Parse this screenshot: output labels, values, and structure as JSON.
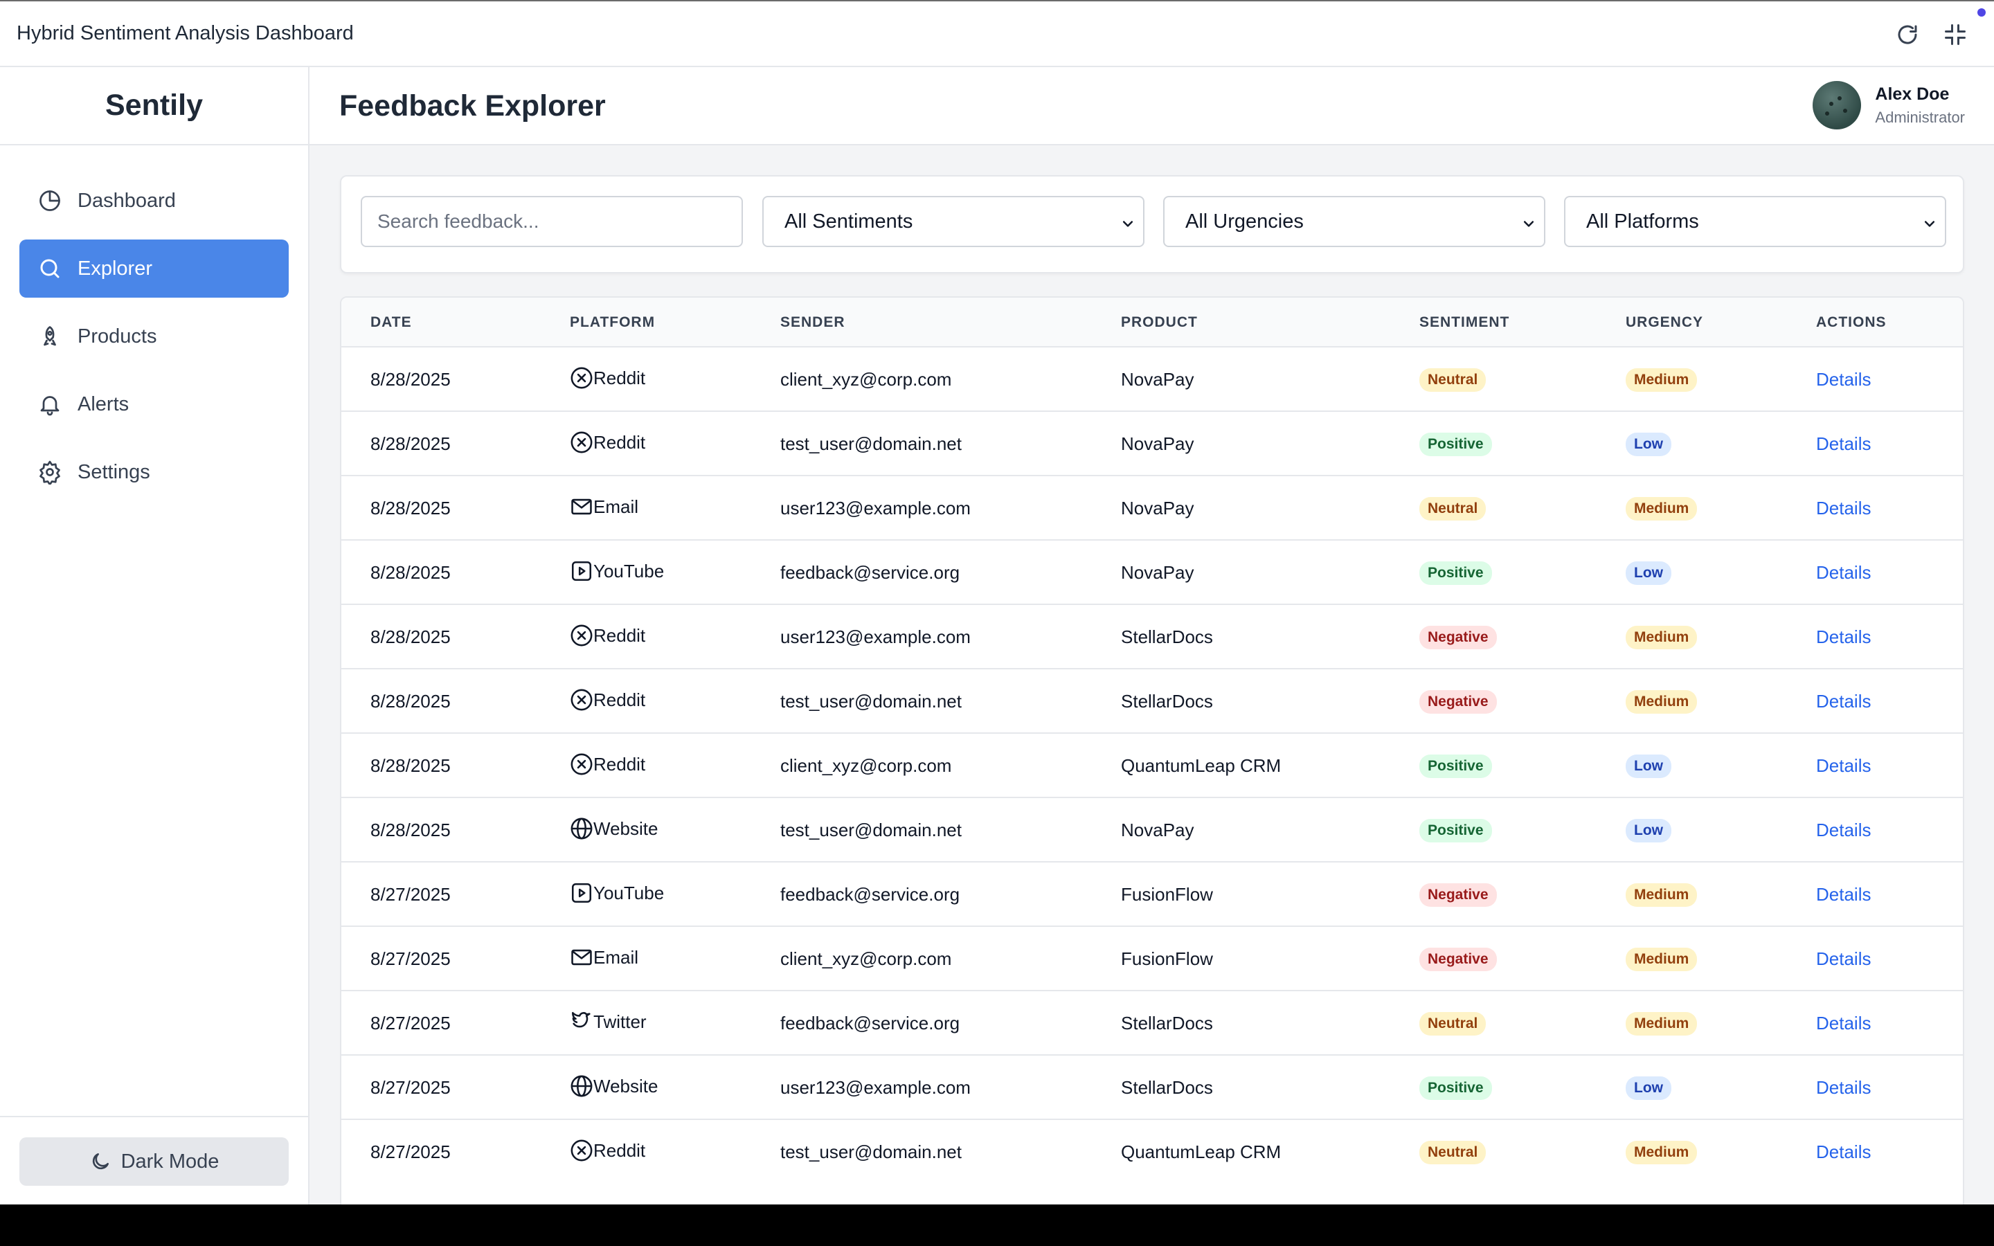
{
  "window": {
    "title": "Hybrid Sentiment Analysis Dashboard"
  },
  "sidebar": {
    "brand": "Sentily",
    "items": [
      {
        "label": "Dashboard",
        "icon": "pie-chart-icon",
        "active": false
      },
      {
        "label": "Explorer",
        "icon": "search-icon",
        "active": true
      },
      {
        "label": "Products",
        "icon": "rocket-icon",
        "active": false
      },
      {
        "label": "Alerts",
        "icon": "bell-icon",
        "active": false
      },
      {
        "label": "Settings",
        "icon": "gear-icon",
        "active": false
      }
    ],
    "dark_mode_label": "Dark Mode"
  },
  "header": {
    "title": "Feedback Explorer",
    "user_name": "Alex Doe",
    "user_role": "Administrator"
  },
  "filters": {
    "search_placeholder": "Search feedback...",
    "sentiment": "All Sentiments",
    "urgency": "All Urgencies",
    "platform": "All Platforms"
  },
  "table": {
    "columns": [
      "DATE",
      "PLATFORM",
      "SENDER",
      "PRODUCT",
      "SENTIMENT",
      "URGENCY",
      "ACTIONS"
    ],
    "rows": [
      {
        "date": "8/28/2025",
        "platform": "Reddit",
        "sender": "client_xyz@corp.com",
        "product": "NovaPay",
        "sentiment": "Neutral",
        "urgency": "Medium",
        "action": "Details"
      },
      {
        "date": "8/28/2025",
        "platform": "Reddit",
        "sender": "test_user@domain.net",
        "product": "NovaPay",
        "sentiment": "Positive",
        "urgency": "Low",
        "action": "Details"
      },
      {
        "date": "8/28/2025",
        "platform": "Email",
        "sender": "user123@example.com",
        "product": "NovaPay",
        "sentiment": "Neutral",
        "urgency": "Medium",
        "action": "Details"
      },
      {
        "date": "8/28/2025",
        "platform": "YouTube",
        "sender": "feedback@service.org",
        "product": "NovaPay",
        "sentiment": "Positive",
        "urgency": "Low",
        "action": "Details"
      },
      {
        "date": "8/28/2025",
        "platform": "Reddit",
        "sender": "user123@example.com",
        "product": "StellarDocs",
        "sentiment": "Negative",
        "urgency": "Medium",
        "action": "Details"
      },
      {
        "date": "8/28/2025",
        "platform": "Reddit",
        "sender": "test_user@domain.net",
        "product": "StellarDocs",
        "sentiment": "Negative",
        "urgency": "Medium",
        "action": "Details"
      },
      {
        "date": "8/28/2025",
        "platform": "Reddit",
        "sender": "client_xyz@corp.com",
        "product": "QuantumLeap CRM",
        "sentiment": "Positive",
        "urgency": "Low",
        "action": "Details"
      },
      {
        "date": "8/28/2025",
        "platform": "Website",
        "sender": "test_user@domain.net",
        "product": "NovaPay",
        "sentiment": "Positive",
        "urgency": "Low",
        "action": "Details"
      },
      {
        "date": "8/27/2025",
        "platform": "YouTube",
        "sender": "feedback@service.org",
        "product": "FusionFlow",
        "sentiment": "Negative",
        "urgency": "Medium",
        "action": "Details"
      },
      {
        "date": "8/27/2025",
        "platform": "Email",
        "sender": "client_xyz@corp.com",
        "product": "FusionFlow",
        "sentiment": "Negative",
        "urgency": "Medium",
        "action": "Details"
      },
      {
        "date": "8/27/2025",
        "platform": "Twitter",
        "sender": "feedback@service.org",
        "product": "StellarDocs",
        "sentiment": "Neutral",
        "urgency": "Medium",
        "action": "Details"
      },
      {
        "date": "8/27/2025",
        "platform": "Website",
        "sender": "user123@example.com",
        "product": "StellarDocs",
        "sentiment": "Positive",
        "urgency": "Low",
        "action": "Details"
      },
      {
        "date": "8/27/2025",
        "platform": "Reddit",
        "sender": "test_user@domain.net",
        "product": "QuantumLeap CRM",
        "sentiment": "Neutral",
        "urgency": "Medium",
        "action": "Details"
      }
    ]
  },
  "colors": {
    "accent": "#4a86e8",
    "link": "#2563eb",
    "positive": "#166534",
    "negative": "#991b1b",
    "neutral": "#92400e",
    "low": "#1e40af"
  }
}
